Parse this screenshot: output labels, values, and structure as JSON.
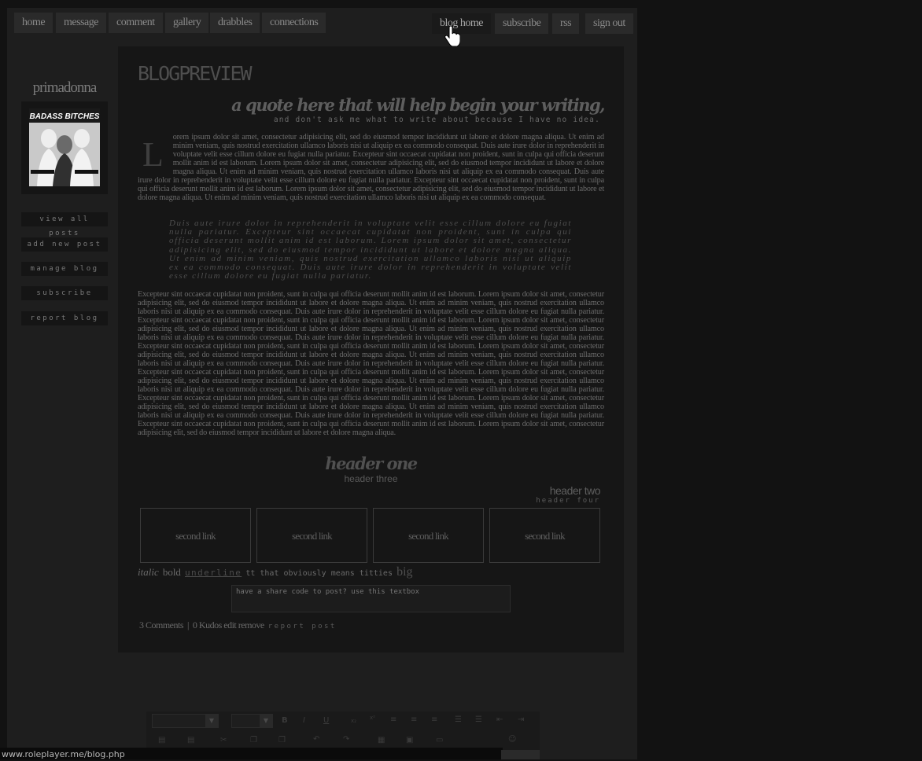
{
  "nav": {
    "left": [
      "home",
      "message",
      "comment",
      "gallery",
      "drabbles",
      "connections"
    ],
    "right": [
      "blog home",
      "subscribe",
      "rss",
      "sign out"
    ]
  },
  "sidebar": {
    "name": "primadonna",
    "avatar_text": "BADASS BITCHES",
    "buttons": [
      "view all posts",
      "add new post",
      "manage blog",
      "subscribe",
      "report blog"
    ]
  },
  "post": {
    "title": "BLOGPREVIEW",
    "quote": "a quote here that will help begin your writing,",
    "quote_sub": "and don't ask me what to write about because I have no idea.",
    "drop_cap": "L",
    "para1": "orem ipsum dolor sit amet, consectetur adipisicing elit, sed do eiusmod tempor incididunt ut labore et dolore magna aliqua. Ut enim ad minim veniam, quis nostrud exercitation ullamco laboris nisi ut aliquip ex ea commodo consequat. Duis aute irure dolor in reprehenderit in voluptate velit esse cillum dolore eu fugiat nulla pariatur. Excepteur sint occaecat cupidatat non proident, sunt in culpa qui officia deserunt mollit anim id est laborum. Lorem ipsum dolor sit amet, consectetur adipisicing elit, sed do eiusmod tempor incididunt ut labore et dolore magna aliqua. Ut enim ad minim veniam, quis nostrud exercitation ullamco laboris nisi ut aliquip ex ea commodo consequat. Duis aute irure dolor in reprehenderit in voluptate velit esse cillum dolore eu fugiat nulla pariatur. Excepteur sint occaecat cupidatat non proident, sunt in culpa qui officia deserunt mollit anim id est laborum. Lorem ipsum dolor sit amet, consectetur adipisicing elit, sed do eiusmod tempor incididunt ut labore et dolore magna aliqua. Ut enim ad minim veniam, quis nostrud exercitation ullamco laboris nisi ut aliquip ex ea commodo consequat.",
    "blockquote": "Duis aute irure dolor in reprehenderit in voluptate velit esse cillum dolore eu fugiat nulla pariatur. Excepteur sint occaecat cupidatat non proident, sunt in culpa qui officia deserunt mollit anim id est laborum. Lorem ipsum dolor sit amet, consectetur adipisicing elit, sed do eiusmod tempor incididunt ut labore et dolore magna aliqua. Ut enim ad minim veniam, quis nostrud exercitation ullamco laboris nisi ut aliquip ex ea commodo consequat. Duis aute irure dolor in reprehenderit in voluptate velit esse cillum dolore eu fugiat nulla pariatur.",
    "para2": "Excepteur sint occaecat cupidatat non proident, sunt in culpa qui officia deserunt mollit anim id est laborum. Lorem ipsum dolor sit amet, consectetur adipisicing elit, sed do eiusmod tempor incididunt ut labore et dolore magna aliqua. Ut enim ad minim veniam, quis nostrud exercitation ullamco laboris nisi ut aliquip ex ea commodo consequat. Duis aute irure dolor in reprehenderit in voluptate velit esse cillum dolore eu fugiat nulla pariatur. Excepteur sint occaecat cupidatat non proident, sunt in culpa qui officia deserunt mollit anim id est laborum. Lorem ipsum dolor sit amet, consectetur adipisicing elit, sed do eiusmod tempor incididunt ut labore et dolore magna aliqua. Ut enim ad minim veniam, quis nostrud exercitation ullamco laboris nisi ut aliquip ex ea commodo consequat. Duis aute irure dolor in reprehenderit in voluptate velit esse cillum dolore eu fugiat nulla pariatur. Excepteur sint occaecat cupidatat non proident, sunt in culpa qui officia deserunt mollit anim id est laborum. Lorem ipsum dolor sit amet, consectetur adipisicing elit, sed do eiusmod tempor incididunt ut labore et dolore magna aliqua. Ut enim ad minim veniam, quis nostrud exercitation ullamco laboris nisi ut aliquip ex ea commodo consequat. Duis aute irure dolor in reprehenderit in voluptate velit esse cillum dolore eu fugiat nulla pariatur. Excepteur sint occaecat cupidatat non proident, sunt in culpa qui officia deserunt mollit anim id est laborum. Lorem ipsum dolor sit amet, consectetur adipisicing elit, sed do eiusmod tempor incididunt ut labore et dolore magna aliqua. Ut enim ad minim veniam, quis nostrud exercitation ullamco laboris nisi ut aliquip ex ea commodo consequat. Duis aute irure dolor in reprehenderit in voluptate velit esse cillum dolore eu fugiat nulla pariatur. Excepteur sint occaecat cupidatat non proident, sunt in culpa qui officia deserunt mollit anim id est laborum. Lorem ipsum dolor sit amet, consectetur adipisicing elit, sed do eiusmod tempor incididunt ut labore et dolore magna aliqua. Ut enim ad minim veniam, quis nostrud exercitation ullamco laboris nisi ut aliquip ex ea commodo consequat. Duis aute irure dolor in reprehenderit in voluptate velit esse cillum dolore eu fugiat nulla pariatur. Excepteur sint occaecat cupidatat non proident, sunt in culpa qui officia deserunt mollit anim id est laborum. Lorem ipsum dolor sit amet, consectetur adipisicing elit, sed do eiusmod tempor incididunt ut labore et dolore magna aliqua.",
    "header_one": "header one",
    "header_three": "header three",
    "header_two": "header two",
    "header_four": "header four",
    "links": [
      "second link",
      "second link",
      "second link",
      "second link"
    ],
    "format": {
      "italic": "italic",
      "bold": "bold",
      "underline": "underline",
      "tt": "tt that obviously means titties",
      "big": "big"
    },
    "share_placeholder": "have a share code to post? use this textbox",
    "footer": {
      "comments": "3 Comments",
      "separator": "|",
      "kudos": "0 Kudos",
      "edit": "edit",
      "remove": "remove",
      "report": "report post"
    }
  },
  "status_url": "www.roleplayer.me/blog.php",
  "colors": {
    "page_bg": "#121212",
    "frame_bg": "#1e1e1e",
    "post_bg": "#161616",
    "button_bg": "#2a2a2a"
  }
}
